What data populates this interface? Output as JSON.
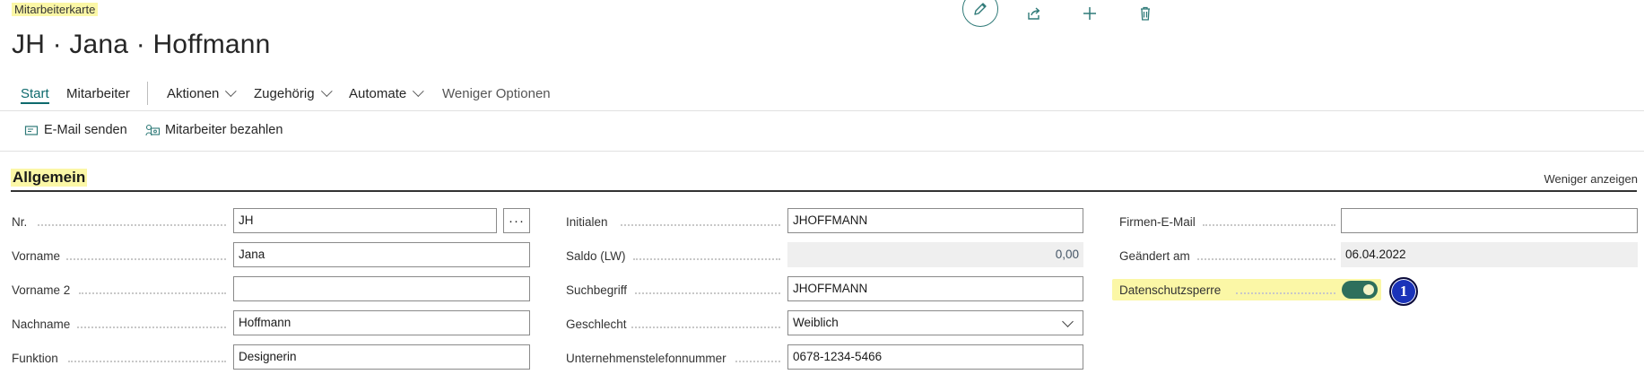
{
  "page": {
    "caption": "Mitarbeiterkarte",
    "title": "JH · Jana · Hoffmann"
  },
  "toolbar": {
    "icons": [
      "pencil-icon",
      "share-icon",
      "plus-icon",
      "trash-icon"
    ]
  },
  "nav": {
    "start": "Start",
    "mitarbeiter": "Mitarbeiter",
    "aktionen": "Aktionen",
    "zugehoerig": "Zugehörig",
    "automate": "Automate",
    "weniger_optionen": "Weniger Optionen"
  },
  "actions": {
    "email": "E-Mail senden",
    "pay": "Mitarbeiter bezahlen"
  },
  "section": {
    "title": "Allgemein",
    "toggle": "Weniger anzeigen"
  },
  "fields": {
    "nr": {
      "label": "Nr.",
      "value": "JH"
    },
    "vorname": {
      "label": "Vorname",
      "value": "Jana"
    },
    "vorname2": {
      "label": "Vorname 2",
      "value": ""
    },
    "nachname": {
      "label": "Nachname",
      "value": "Hoffmann"
    },
    "funktion": {
      "label": "Funktion",
      "value": "Designerin"
    },
    "initialen": {
      "label": "Initialen",
      "value": "JHOFFMANN"
    },
    "saldo": {
      "label": "Saldo (LW)",
      "value": "0,00"
    },
    "suchbegriff": {
      "label": "Suchbegriff",
      "value": "JHOFFMANN"
    },
    "geschlecht": {
      "label": "Geschlecht",
      "value": "Weiblich"
    },
    "telefon": {
      "label": "Unternehmenstelefonnummer",
      "value": "0678-1234-5466"
    },
    "firmen_email": {
      "label": "Firmen-E-Mail",
      "value": ""
    },
    "geaendert": {
      "label": "Geändert am",
      "value": "06.04.2022"
    },
    "datenschutz": {
      "label": "Datenschutzsperre",
      "value": true
    }
  },
  "badge": "1",
  "colors": {
    "accent": "#0e6a6d",
    "highlight": "#fbf7a6",
    "toggle": "#2e6f5c",
    "badge": "#1a33b9"
  }
}
